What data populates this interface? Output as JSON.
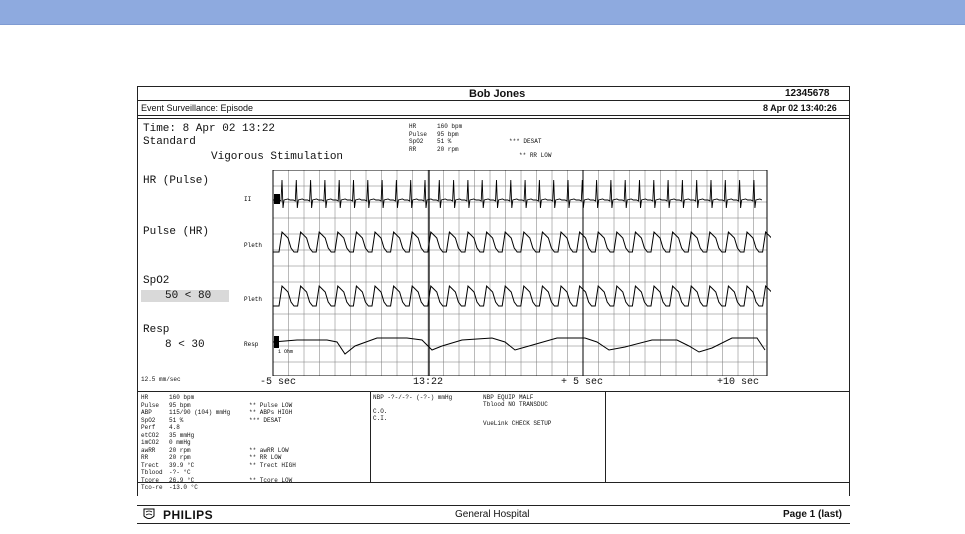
{
  "header": {
    "patient_name": "Bob Jones",
    "patient_id": "12345678",
    "report_type": "Event Surveillance: Episode",
    "report_datetime": "8 Apr 02 13:40:26"
  },
  "event": {
    "time_label": "Time: 8 Apr 02 13:22",
    "standard": "Standard",
    "annotation": "Vigorous Stimulation",
    "vitals": [
      {
        "label": "HR",
        "value": "160 bpm"
      },
      {
        "label": "Pulse",
        "value": "95 bpm"
      },
      {
        "label": "SpO2",
        "value": "51 %"
      },
      {
        "label": "RR",
        "value": "20 rpm"
      }
    ],
    "alarms": [
      {
        "level": "***",
        "text": "DESAT"
      },
      {
        "level": "**",
        "text": "RR   LOW"
      }
    ]
  },
  "left_labels": {
    "hr_pulse": "HR (Pulse)",
    "pulse_hr": "Pulse (HR)",
    "spo2": "SpO2",
    "spo2_range": "50 < 80",
    "resp": "Resp",
    "resp_range": "8 < 30",
    "speed": "12.5 mm/sec"
  },
  "waves": {
    "labels": [
      "II",
      "Pleth",
      "Pleth",
      "Resp"
    ],
    "resp_gain": "1 Ohm"
  },
  "time_axis": [
    "-5 sec",
    "13:22",
    "+ 5 sec",
    "+10 sec"
  ],
  "numerics": {
    "rows": [
      {
        "label": "HR",
        "value": "160 bpm",
        "alarm": ""
      },
      {
        "label": "Pulse",
        "value": "95 bpm",
        "alarm": "** Pulse  LOW"
      },
      {
        "label": "ABP",
        "value": "115/90 (104) mmHg",
        "alarm": "** ABPs  HIGH"
      },
      {
        "label": "SpO2",
        "value": "51 %",
        "alarm": "*** DESAT"
      },
      {
        "label": "Perf",
        "value": "4.8",
        "alarm": ""
      },
      {
        "label": "etCO2",
        "value": "35 mmHg",
        "alarm": ""
      },
      {
        "label": "imCO2",
        "value": "0 mmHg",
        "alarm": ""
      },
      {
        "label": "awRR",
        "value": "20 rpm",
        "alarm": "** awRR   LOW"
      },
      {
        "label": "RR",
        "value": "20 rpm",
        "alarm": "** RR     LOW"
      },
      {
        "label": "Trect",
        "value": "39.9 °C",
        "alarm": "** Trect  HIGH"
      },
      {
        "label": "Tblood",
        "value": "-?- °C",
        "alarm": ""
      },
      {
        "label": "Tcore",
        "value": "26.9 °C",
        "alarm": "** Tcore  LOW"
      },
      {
        "label": "Tco-re",
        "value": "-13.0 °C",
        "alarm": ""
      }
    ]
  },
  "middle_panel": {
    "nbp": "NBP     -?-/-?- (-?-) mmHg",
    "co": "C.O.",
    "ci": "C.I.",
    "inop1": "NBP    EQUIP MALF",
    "inop2": "Tblood NO TRANSDUC",
    "inop3": "VueLink CHECK SETUP"
  },
  "footer": {
    "brand": "PHILIPS",
    "hospital": "General Hospital",
    "page": "Page 1 (last)"
  }
}
